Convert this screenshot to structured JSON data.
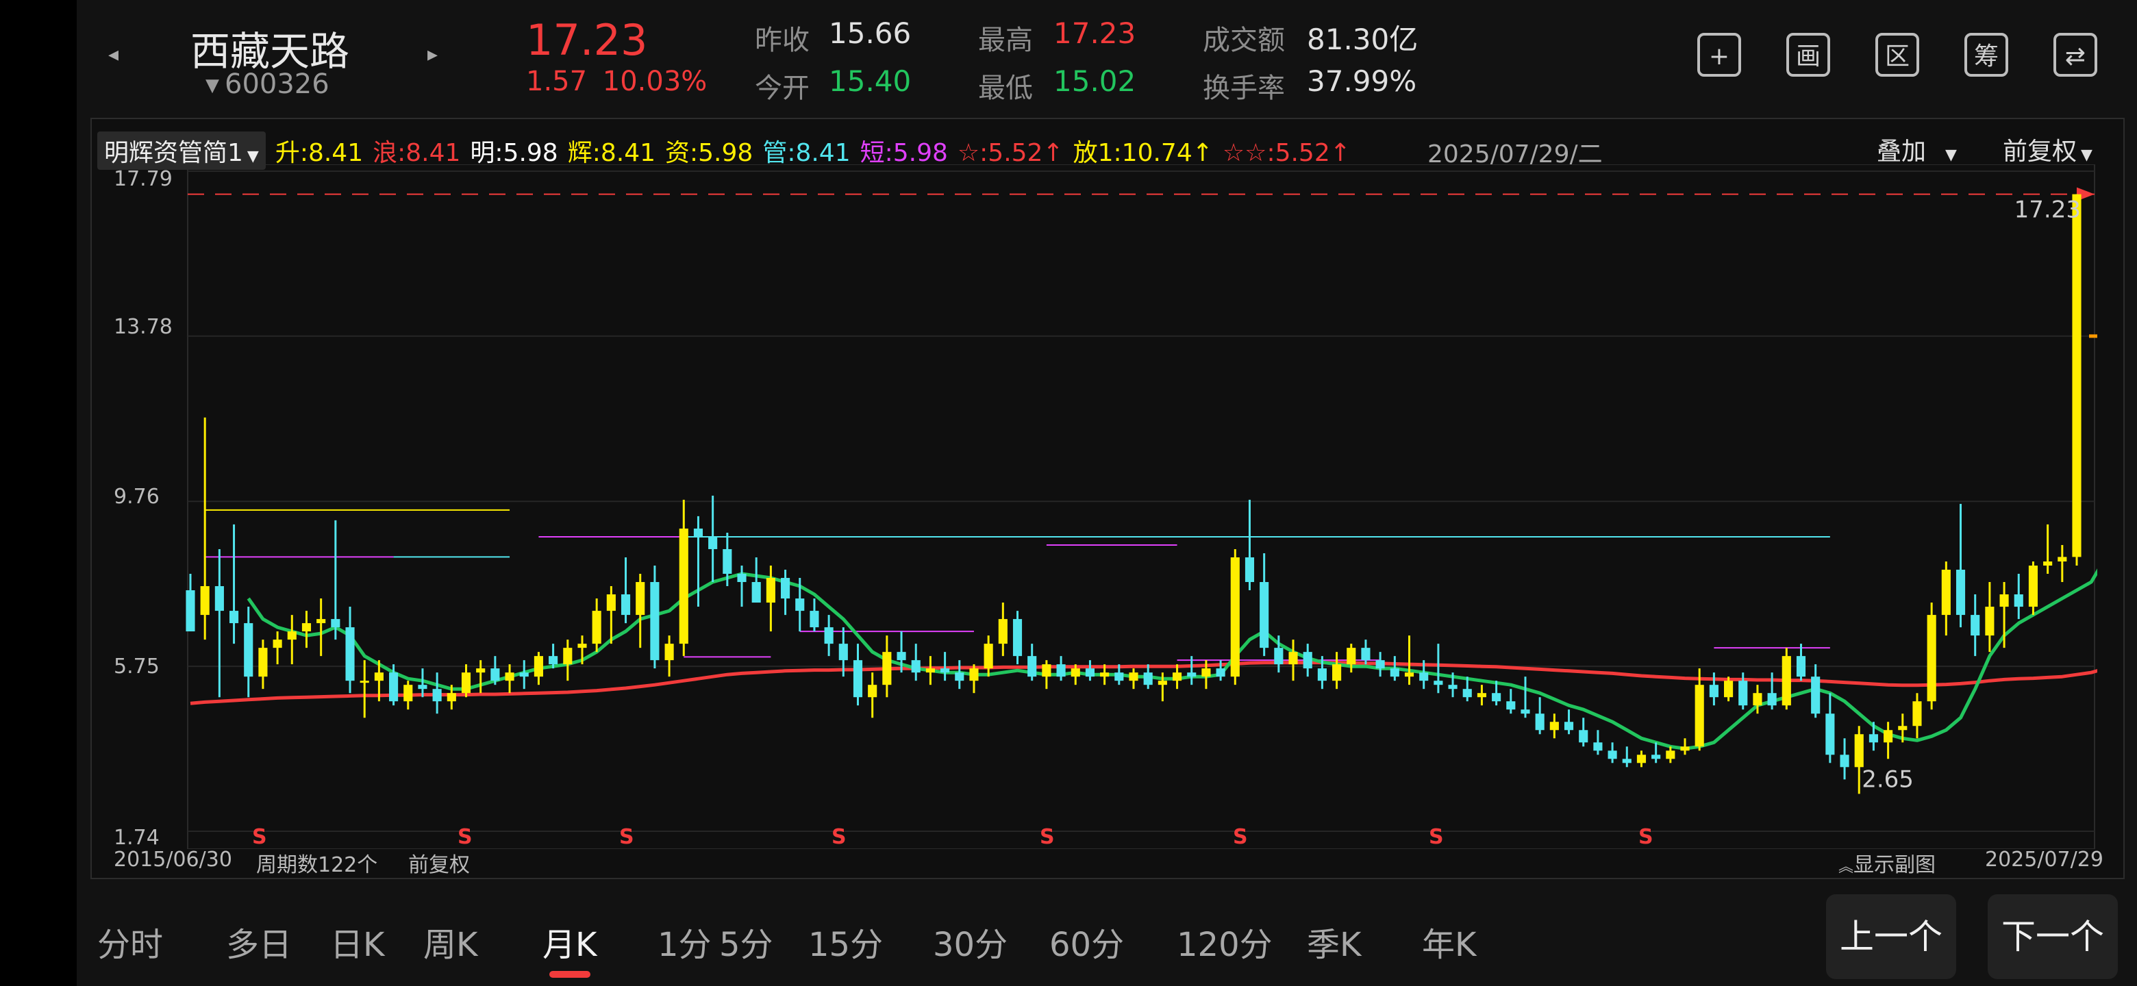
{
  "colors": {
    "up": "#f23b3b",
    "down": "#22c55e",
    "yellow": "#ffee00",
    "cyan": "#52e5ee",
    "magenta": "#e040fb"
  },
  "header": {
    "prev_icon": "chevron-left-icon",
    "next_icon": "chevron-right-icon",
    "stock_name": "西藏天路",
    "stock_code": "600326",
    "price": "17.23",
    "change": "1.57",
    "change_pct": "10.03%",
    "quotes": [
      {
        "label": "昨收",
        "value": "15.66",
        "color": "#e0e0e0"
      },
      {
        "label": "今开",
        "value": "15.40",
        "color": "#22c55e"
      },
      {
        "label": "最高",
        "value": "17.23",
        "color": "#f23b3b"
      },
      {
        "label": "最低",
        "value": "15.02",
        "color": "#22c55e"
      },
      {
        "label": "成交额",
        "value": "81.30亿",
        "color": "#e0e0e0"
      },
      {
        "label": "换手率",
        "value": "37.99%",
        "color": "#e0e0e0"
      }
    ],
    "tools": [
      {
        "name": "plus",
        "glyph": "+"
      },
      {
        "name": "draw",
        "glyph": "画"
      },
      {
        "name": "range",
        "glyph": "区"
      },
      {
        "name": "chip",
        "glyph": "筹"
      },
      {
        "name": "switch-screen",
        "glyph": "⇄"
      }
    ]
  },
  "indicator_bar": {
    "selector": "明辉资管简1",
    "items": [
      {
        "label": "升:8.41",
        "color": "#ffee00"
      },
      {
        "label": "浪:8.41",
        "color": "#f23b3b"
      },
      {
        "label": "明:5.98",
        "color": "#ffffff"
      },
      {
        "label": "辉:8.41",
        "color": "#ffee00"
      },
      {
        "label": "资:5.98",
        "color": "#ffee00"
      },
      {
        "label": "管:8.41",
        "color": "#52e5ee"
      },
      {
        "label": "短:5.98",
        "color": "#e040fb"
      },
      {
        "label": "☆:5.52↑",
        "color": "#f23b3b"
      },
      {
        "label": "放1:10.74↑",
        "color": "#ffee00"
      },
      {
        "label": "☆☆:5.52↑",
        "color": "#f23b3b"
      }
    ],
    "date": "2025/07/29/二",
    "overlay": "叠加",
    "adjust": "前复权"
  },
  "chart_data": {
    "type": "candlestick",
    "period": "月K",
    "y_ticks": [
      "17.79",
      "13.78",
      "9.76",
      "5.75",
      "1.74"
    ],
    "ylim": [
      1.74,
      17.79
    ],
    "price_label": "17.23",
    "low_label": "2.65",
    "sell_marks": [
      "S",
      "S",
      "S",
      "S",
      "S",
      "S",
      "S",
      "S"
    ],
    "start_date": "2015/06/30",
    "period_count": "周期数122个",
    "adjust_label": "前复权",
    "show_sub": "显示副图",
    "end_date": "2025/07/29",
    "candles": [
      [
        7.6,
        8.0,
        7.0,
        6.6
      ],
      [
        7.0,
        11.8,
        6.4,
        7.7
      ],
      [
        7.7,
        8.6,
        5.0,
        7.1
      ],
      [
        7.1,
        9.2,
        6.3,
        6.8
      ],
      [
        6.8,
        7.2,
        5.0,
        5.5
      ],
      [
        5.5,
        6.4,
        5.2,
        6.2
      ],
      [
        6.2,
        6.6,
        5.8,
        6.4
      ],
      [
        6.4,
        7.0,
        5.8,
        6.6
      ],
      [
        6.6,
        7.1,
        6.2,
        6.8
      ],
      [
        6.8,
        7.4,
        6.0,
        6.9
      ],
      [
        6.9,
        9.3,
        6.4,
        6.7
      ],
      [
        6.7,
        7.2,
        5.1,
        5.4
      ],
      [
        5.4,
        5.9,
        4.5,
        5.4
      ],
      [
        5.4,
        5.9,
        4.9,
        5.6
      ],
      [
        5.6,
        5.8,
        4.8,
        4.9
      ],
      [
        4.9,
        5.4,
        4.7,
        5.3
      ],
      [
        5.3,
        5.7,
        5.0,
        5.2
      ],
      [
        5.2,
        5.6,
        4.6,
        4.9
      ],
      [
        4.9,
        5.3,
        4.7,
        5.1
      ],
      [
        5.1,
        5.8,
        5.0,
        5.6
      ],
      [
        5.6,
        5.9,
        5.1,
        5.7
      ],
      [
        5.7,
        6.0,
        5.3,
        5.4
      ],
      [
        5.4,
        5.8,
        5.1,
        5.6
      ],
      [
        5.6,
        5.9,
        5.2,
        5.5
      ],
      [
        5.5,
        6.1,
        5.3,
        6.0
      ],
      [
        6.0,
        6.3,
        5.7,
        5.8
      ],
      [
        5.8,
        6.4,
        5.4,
        6.2
      ],
      [
        6.2,
        6.5,
        5.8,
        6.3
      ],
      [
        6.3,
        7.4,
        6.1,
        7.1
      ],
      [
        7.1,
        7.7,
        6.3,
        7.5
      ],
      [
        7.5,
        8.4,
        6.8,
        7.0
      ],
      [
        7.0,
        8.0,
        6.2,
        7.8
      ],
      [
        7.8,
        8.2,
        5.7,
        5.9
      ],
      [
        5.9,
        6.5,
        5.5,
        6.3
      ],
      [
        6.3,
        9.8,
        6.0,
        9.1
      ],
      [
        9.1,
        9.4,
        7.2,
        8.9
      ],
      [
        8.9,
        9.9,
        7.8,
        8.6
      ],
      [
        8.6,
        9.0,
        7.7,
        8.0
      ],
      [
        8.0,
        8.2,
        7.2,
        7.8
      ],
      [
        7.8,
        8.4,
        7.3,
        7.3
      ],
      [
        7.3,
        8.2,
        6.6,
        7.9
      ],
      [
        7.9,
        8.1,
        7.0,
        7.4
      ],
      [
        7.4,
        7.9,
        6.6,
        7.1
      ],
      [
        7.1,
        7.4,
        6.6,
        6.7
      ],
      [
        6.7,
        7.0,
        6.0,
        6.3
      ],
      [
        6.3,
        6.7,
        5.5,
        5.9
      ],
      [
        5.9,
        6.3,
        4.8,
        5.0
      ],
      [
        5.0,
        5.6,
        4.5,
        5.3
      ],
      [
        5.3,
        6.5,
        5.0,
        6.1
      ],
      [
        6.1,
        6.6,
        5.6,
        5.9
      ],
      [
        5.9,
        6.3,
        5.4,
        5.6
      ],
      [
        5.6,
        6.0,
        5.3,
        5.7
      ],
      [
        5.7,
        6.1,
        5.4,
        5.6
      ],
      [
        5.6,
        5.9,
        5.2,
        5.4
      ],
      [
        5.4,
        5.8,
        5.1,
        5.7
      ],
      [
        5.7,
        6.5,
        5.5,
        6.3
      ],
      [
        6.3,
        7.3,
        6.0,
        6.9
      ],
      [
        6.9,
        7.1,
        5.8,
        6.0
      ],
      [
        6.0,
        6.3,
        5.4,
        5.5
      ],
      [
        5.5,
        5.9,
        5.2,
        5.8
      ],
      [
        5.8,
        6.0,
        5.4,
        5.5
      ],
      [
        5.5,
        5.8,
        5.3,
        5.7
      ],
      [
        5.7,
        5.9,
        5.4,
        5.5
      ],
      [
        5.5,
        5.8,
        5.3,
        5.6
      ],
      [
        5.6,
        5.8,
        5.3,
        5.4
      ],
      [
        5.4,
        5.7,
        5.2,
        5.6
      ],
      [
        5.6,
        5.8,
        5.2,
        5.3
      ],
      [
        5.3,
        5.6,
        4.9,
        5.4
      ],
      [
        5.4,
        5.8,
        5.2,
        5.6
      ],
      [
        5.6,
        6.0,
        5.3,
        5.5
      ],
      [
        5.5,
        5.9,
        5.2,
        5.7
      ],
      [
        5.7,
        5.9,
        5.4,
        5.5
      ],
      [
        5.5,
        8.6,
        5.3,
        8.4
      ],
      [
        8.4,
        9.8,
        7.6,
        7.8
      ],
      [
        7.8,
        8.5,
        6.0,
        6.2
      ],
      [
        6.2,
        6.5,
        5.6,
        5.8
      ],
      [
        5.8,
        6.4,
        5.4,
        6.1
      ],
      [
        6.1,
        6.3,
        5.5,
        5.7
      ],
      [
        5.7,
        6.0,
        5.2,
        5.4
      ],
      [
        5.4,
        6.1,
        5.2,
        5.8
      ],
      [
        5.8,
        6.3,
        5.6,
        6.2
      ],
      [
        6.2,
        6.4,
        5.8,
        5.9
      ],
      [
        5.9,
        6.1,
        5.5,
        5.7
      ],
      [
        5.7,
        6.0,
        5.4,
        5.5
      ],
      [
        5.5,
        6.5,
        5.3,
        5.6
      ],
      [
        5.6,
        5.9,
        5.2,
        5.4
      ],
      [
        5.4,
        6.3,
        5.1,
        5.3
      ],
      [
        5.3,
        5.6,
        5.0,
        5.2
      ],
      [
        5.2,
        5.5,
        4.9,
        5.0
      ],
      [
        5.0,
        5.3,
        4.8,
        5.1
      ],
      [
        5.1,
        5.4,
        4.8,
        4.9
      ],
      [
        4.9,
        5.2,
        4.6,
        4.7
      ],
      [
        4.7,
        5.5,
        4.5,
        4.6
      ],
      [
        4.6,
        5.0,
        4.1,
        4.2
      ],
      [
        4.2,
        4.6,
        4.0,
        4.4
      ],
      [
        4.4,
        4.7,
        4.1,
        4.2
      ],
      [
        4.2,
        4.5,
        3.8,
        3.9
      ],
      [
        3.9,
        4.2,
        3.6,
        3.7
      ],
      [
        3.7,
        3.9,
        3.4,
        3.5
      ],
      [
        3.5,
        3.8,
        3.3,
        3.4
      ],
      [
        3.4,
        3.7,
        3.3,
        3.6
      ],
      [
        3.6,
        3.9,
        3.4,
        3.5
      ],
      [
        3.5,
        3.8,
        3.4,
        3.7
      ],
      [
        3.7,
        4.0,
        3.6,
        3.8
      ],
      [
        3.8,
        5.7,
        3.7,
        5.3
      ],
      [
        5.3,
        5.6,
        4.8,
        5.0
      ],
      [
        5.0,
        5.5,
        4.9,
        5.4
      ],
      [
        5.4,
        5.6,
        4.7,
        4.8
      ],
      [
        4.8,
        5.3,
        4.6,
        5.1
      ],
      [
        5.1,
        5.6,
        4.7,
        4.8
      ],
      [
        4.8,
        6.2,
        4.7,
        6.0
      ],
      [
        6.0,
        6.3,
        5.4,
        5.5
      ],
      [
        5.5,
        5.8,
        4.5,
        4.6
      ],
      [
        4.6,
        5.1,
        3.4,
        3.6
      ],
      [
        3.6,
        4.0,
        3.0,
        3.3
      ],
      [
        3.3,
        4.3,
        2.65,
        4.1
      ],
      [
        4.1,
        4.4,
        3.7,
        3.9
      ],
      [
        3.9,
        4.4,
        3.5,
        4.2
      ],
      [
        4.2,
        4.6,
        3.9,
        4.3
      ],
      [
        4.3,
        5.1,
        4.0,
        4.9
      ],
      [
        4.9,
        7.3,
        4.7,
        7.0
      ],
      [
        7.0,
        8.3,
        6.5,
        8.1
      ],
      [
        8.1,
        9.7,
        6.7,
        7.0
      ],
      [
        7.0,
        7.5,
        6.0,
        6.5
      ],
      [
        6.5,
        7.8,
        6.1,
        7.2
      ],
      [
        7.2,
        7.8,
        6.2,
        7.5
      ],
      [
        7.5,
        8.0,
        6.9,
        7.2
      ],
      [
        7.2,
        8.3,
        7.0,
        8.2
      ],
      [
        8.2,
        9.2,
        8.0,
        8.3
      ],
      [
        8.3,
        8.7,
        7.8,
        8.41
      ],
      [
        8.41,
        17.23,
        8.2,
        17.23
      ]
    ],
    "ma_green": [
      null,
      null,
      null,
      null,
      7.4,
      6.9,
      6.7,
      6.6,
      6.5,
      6.55,
      6.7,
      6.5,
      6.0,
      5.8,
      5.6,
      5.45,
      5.4,
      5.3,
      5.2,
      5.2,
      5.3,
      5.4,
      5.5,
      5.6,
      5.7,
      5.75,
      5.8,
      5.9,
      6.1,
      6.4,
      6.6,
      6.9,
      7.0,
      7.1,
      7.4,
      7.6,
      7.8,
      7.9,
      8.0,
      7.95,
      7.9,
      7.8,
      7.7,
      7.5,
      7.2,
      6.9,
      6.5,
      6.1,
      5.9,
      5.8,
      5.7,
      5.65,
      5.6,
      5.6,
      5.55,
      5.55,
      5.6,
      5.65,
      5.6,
      5.55,
      5.55,
      5.6,
      5.55,
      5.55,
      5.55,
      5.5,
      5.5,
      5.45,
      5.45,
      5.5,
      5.5,
      5.55,
      6.0,
      6.4,
      6.6,
      6.3,
      6.1,
      5.95,
      5.85,
      5.8,
      5.75,
      5.75,
      5.7,
      5.7,
      5.65,
      5.6,
      5.55,
      5.5,
      5.45,
      5.4,
      5.35,
      5.3,
      5.2,
      5.1,
      4.95,
      4.8,
      4.7,
      4.55,
      4.4,
      4.2,
      4.0,
      3.9,
      3.8,
      3.75,
      3.8,
      3.9,
      4.2,
      4.5,
      4.8,
      4.9,
      5.0,
      5.1,
      5.2,
      5.1,
      4.9,
      4.6,
      4.3,
      4.1,
      4.0,
      3.95,
      4.05,
      4.2,
      4.5,
      5.2,
      6.0,
      6.5,
      6.8,
      7.0,
      7.2,
      7.4,
      7.6,
      7.8,
      8.4
    ],
    "ma_red": [
      4.85,
      4.88,
      4.9,
      4.92,
      4.94,
      4.96,
      4.98,
      4.99,
      5.0,
      5.01,
      5.02,
      5.03,
      5.04,
      5.04,
      5.05,
      5.05,
      5.06,
      5.06,
      5.06,
      5.06,
      5.07,
      5.07,
      5.08,
      5.09,
      5.1,
      5.11,
      5.12,
      5.14,
      5.16,
      5.19,
      5.22,
      5.26,
      5.3,
      5.35,
      5.4,
      5.45,
      5.5,
      5.55,
      5.58,
      5.6,
      5.62,
      5.64,
      5.65,
      5.66,
      5.66,
      5.67,
      5.67,
      5.68,
      5.69,
      5.7,
      5.7,
      5.71,
      5.71,
      5.72,
      5.72,
      5.72,
      5.73,
      5.73,
      5.73,
      5.74,
      5.74,
      5.74,
      5.74,
      5.74,
      5.74,
      5.75,
      5.75,
      5.75,
      5.75,
      5.76,
      5.77,
      5.79,
      5.81,
      5.83,
      5.84,
      5.84,
      5.84,
      5.84,
      5.84,
      5.84,
      5.83,
      5.82,
      5.82,
      5.81,
      5.8,
      5.79,
      5.78,
      5.77,
      5.76,
      5.75,
      5.74,
      5.72,
      5.7,
      5.68,
      5.66,
      5.64,
      5.62,
      5.6,
      5.58,
      5.55,
      5.52,
      5.5,
      5.48,
      5.46,
      5.45,
      5.44,
      5.43,
      5.43,
      5.42,
      5.42,
      5.41,
      5.41,
      5.4,
      5.38,
      5.36,
      5.34,
      5.32,
      5.3,
      5.29,
      5.29,
      5.3,
      5.31,
      5.33,
      5.36,
      5.4,
      5.43,
      5.45,
      5.46,
      5.48,
      5.5,
      5.55,
      5.6,
      5.7,
      5.8,
      5.95,
      6.2
    ],
    "hlines": [
      {
        "y": 9.55,
        "x0": 1,
        "x1": 22,
        "color": "#ffee00"
      },
      {
        "y": 8.41,
        "x0": 1,
        "x1": 14,
        "color": "#e040fb"
      },
      {
        "y": 8.41,
        "x0": 14,
        "x1": 22,
        "color": "#52e5ee"
      },
      {
        "y": 8.9,
        "x0": 24,
        "x1": 34,
        "color": "#e040fb"
      },
      {
        "y": 8.9,
        "x0": 34,
        "x1": 113,
        "color": "#52e5ee"
      },
      {
        "y": 8.7,
        "x0": 59,
        "x1": 68,
        "color": "#e040fb"
      },
      {
        "y": 6.6,
        "x0": 42,
        "x1": 54,
        "color": "#e040fb"
      },
      {
        "y": 5.98,
        "x0": 34,
        "x1": 40,
        "color": "#e040fb"
      },
      {
        "y": 5.9,
        "x0": 68,
        "x1": 82,
        "color": "#e040fb"
      },
      {
        "y": 6.2,
        "x0": 105,
        "x1": 113,
        "color": "#e040fb"
      }
    ]
  },
  "tabs": [
    "分时",
    "多日",
    "日K",
    "周K",
    "月K",
    "1分",
    "5分",
    "15分",
    "30分",
    "60分",
    "120分",
    "季K",
    "年K"
  ],
  "active_tab": 4,
  "nav": {
    "prev": "上一个",
    "next": "下一个"
  }
}
